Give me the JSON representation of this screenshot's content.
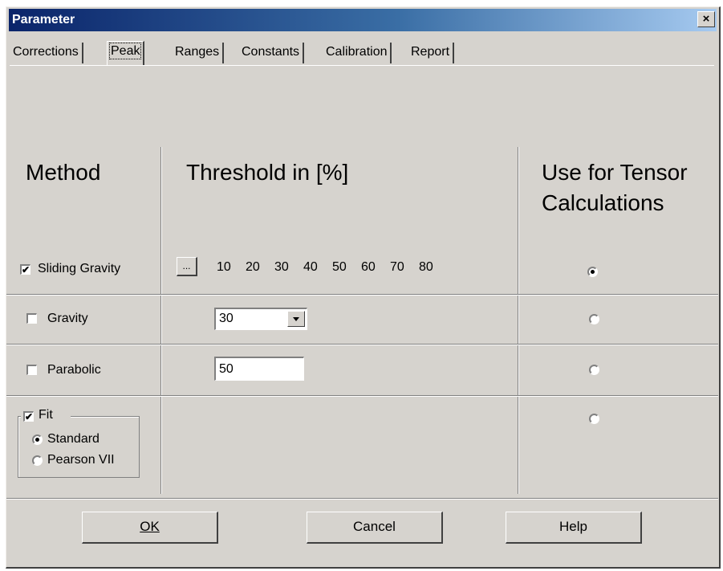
{
  "window": {
    "title": "Parameter",
    "close_glyph": "×"
  },
  "tabs": [
    {
      "label": "Corrections",
      "active": false
    },
    {
      "label": "Peak",
      "active": true
    },
    {
      "label": "Ranges",
      "active": false
    },
    {
      "label": "Constants",
      "active": false
    },
    {
      "label": "Calibration",
      "active": false
    },
    {
      "label": "Report",
      "active": false
    }
  ],
  "headings": {
    "method": "Method",
    "threshold": "Threshold in [%]",
    "tensor_line1": "Use for Tensor",
    "tensor_line2": "Calculations"
  },
  "rows": {
    "sliding_gravity": {
      "label": "Sliding Gravity",
      "checked": true,
      "ellipsis_label": "...",
      "thresholds": [
        "10",
        "20",
        "30",
        "40",
        "50",
        "60",
        "70",
        "80"
      ],
      "tensor_selected": true
    },
    "gravity": {
      "label": "Gravity",
      "checked": false,
      "threshold_value": "30",
      "tensor_selected": false
    },
    "parabolic": {
      "label": "Parabolic",
      "checked": false,
      "threshold_value": "50",
      "tensor_selected": false
    },
    "fit": {
      "label": "Fit",
      "checked": true,
      "options": [
        "Standard",
        "Pearson VII"
      ],
      "selected_option": "Standard",
      "tensor_selected": false
    }
  },
  "buttons": {
    "ok": "OK",
    "cancel": "Cancel",
    "help": "Help"
  },
  "colors": {
    "dialog_bg": "#d6d3ce",
    "title_start": "#0a246a",
    "title_end": "#a6caf0"
  }
}
